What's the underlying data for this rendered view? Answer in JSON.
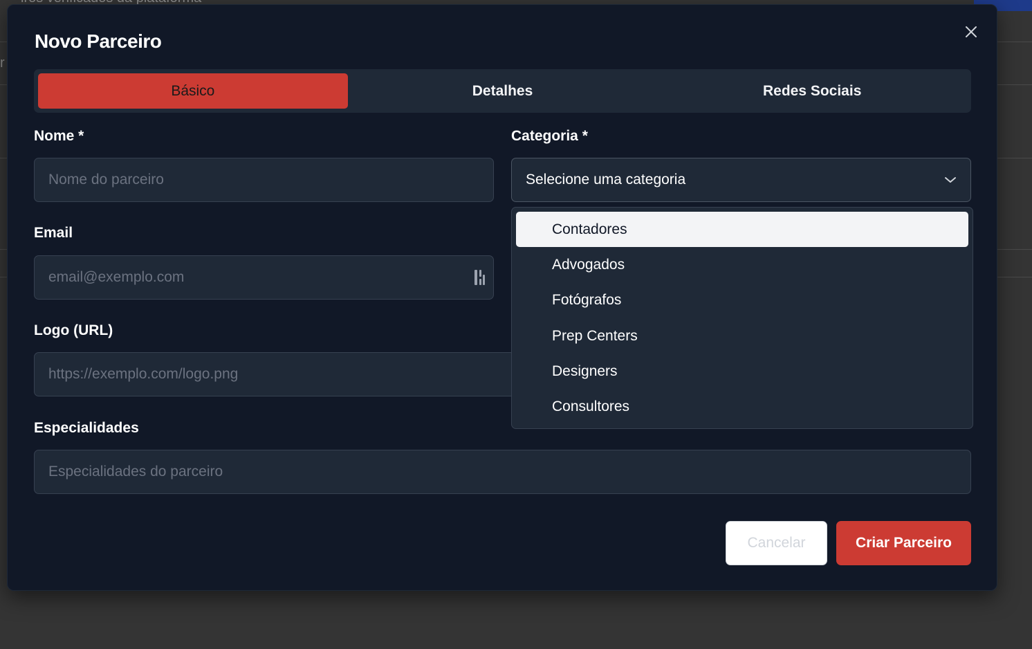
{
  "background": {
    "partial_text": "iros verificados da plataforma",
    "partial_char": "r"
  },
  "modal": {
    "title": "Novo Parceiro",
    "close_icon": "close-icon"
  },
  "tabs": [
    {
      "label": "Básico",
      "active": true
    },
    {
      "label": "Detalhes",
      "active": false
    },
    {
      "label": "Redes Sociais",
      "active": false
    }
  ],
  "form": {
    "nome": {
      "label": "Nome *",
      "placeholder": "Nome do parceiro",
      "value": ""
    },
    "categoria": {
      "label": "Categoria *",
      "value": "Selecione uma categoria"
    },
    "email": {
      "label": "Email",
      "placeholder": "email@exemplo.com",
      "value": ""
    },
    "logo": {
      "label": "Logo (URL)",
      "placeholder": "https://exemplo.com/logo.png",
      "value": ""
    },
    "especialidades": {
      "label": "Especialidades",
      "placeholder": "Especialidades do parceiro",
      "value": ""
    }
  },
  "dropdown": {
    "options": [
      "Contadores",
      "Advogados",
      "Fotógrafos",
      "Prep Centers",
      "Designers",
      "Consultores"
    ],
    "highlighted": "Contadores"
  },
  "footer": {
    "cancel_label": "Cancelar",
    "submit_label": "Criar Parceiro"
  },
  "colors": {
    "accent": "#cc3b33",
    "modal_bg": "#111827",
    "field_bg": "#1f2937"
  }
}
